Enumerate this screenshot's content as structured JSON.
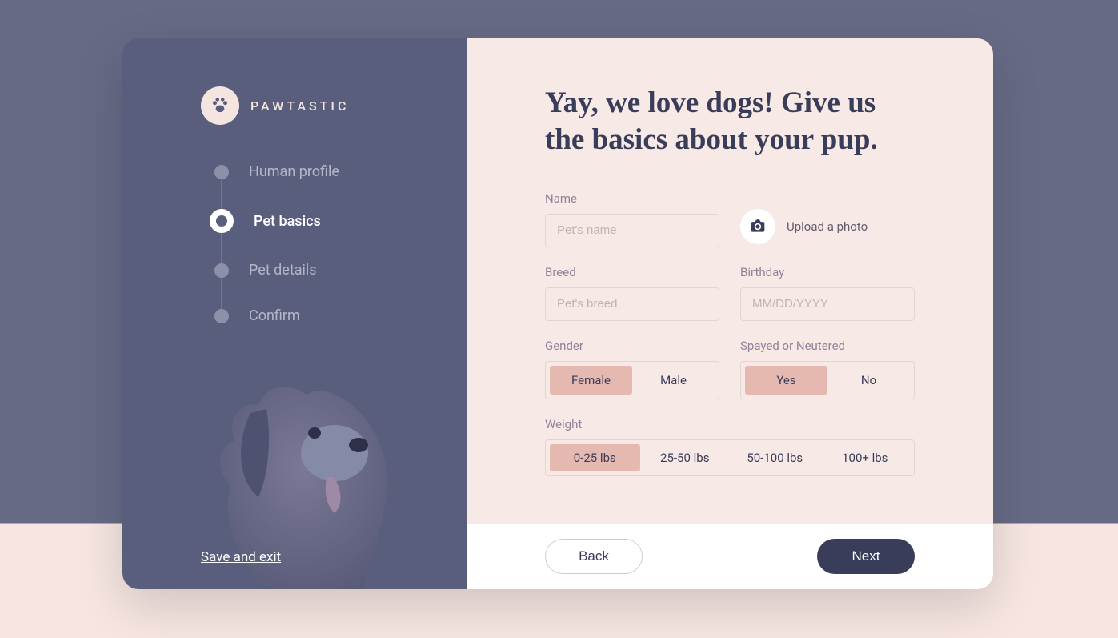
{
  "brand": "PAWTASTIC",
  "sidebar": {
    "steps": [
      {
        "label": "Human profile",
        "active": false
      },
      {
        "label": "Pet basics",
        "active": true
      },
      {
        "label": "Pet details",
        "active": false
      },
      {
        "label": "Confirm",
        "active": false
      }
    ],
    "save_exit": "Save and exit"
  },
  "heading": "Yay, we love dogs! Give us the basics about your pup.",
  "form": {
    "name": {
      "label": "Name",
      "placeholder": "Pet's name",
      "value": ""
    },
    "upload": {
      "label": "Upload a photo"
    },
    "breed": {
      "label": "Breed",
      "placeholder": "Pet's breed",
      "value": ""
    },
    "birthday": {
      "label": "Birthday",
      "placeholder": "MM/DD/YYYY",
      "value": ""
    },
    "gender": {
      "label": "Gender",
      "options": [
        "Female",
        "Male"
      ],
      "selected": "Female"
    },
    "spayed": {
      "label": "Spayed or Neutered",
      "options": [
        "Yes",
        "No"
      ],
      "selected": "Yes"
    },
    "weight": {
      "label": "Weight",
      "options": [
        "0-25 lbs",
        "25-50 lbs",
        "50-100 lbs",
        "100+ lbs"
      ],
      "selected": "0-25 lbs"
    }
  },
  "footer": {
    "back": "Back",
    "next": "Next"
  },
  "colors": {
    "sidebar_bg": "#5a5e7d",
    "main_bg": "#f7e9e5",
    "accent_pink": "#e5b8b0",
    "dark_text": "#3a3d5a"
  }
}
